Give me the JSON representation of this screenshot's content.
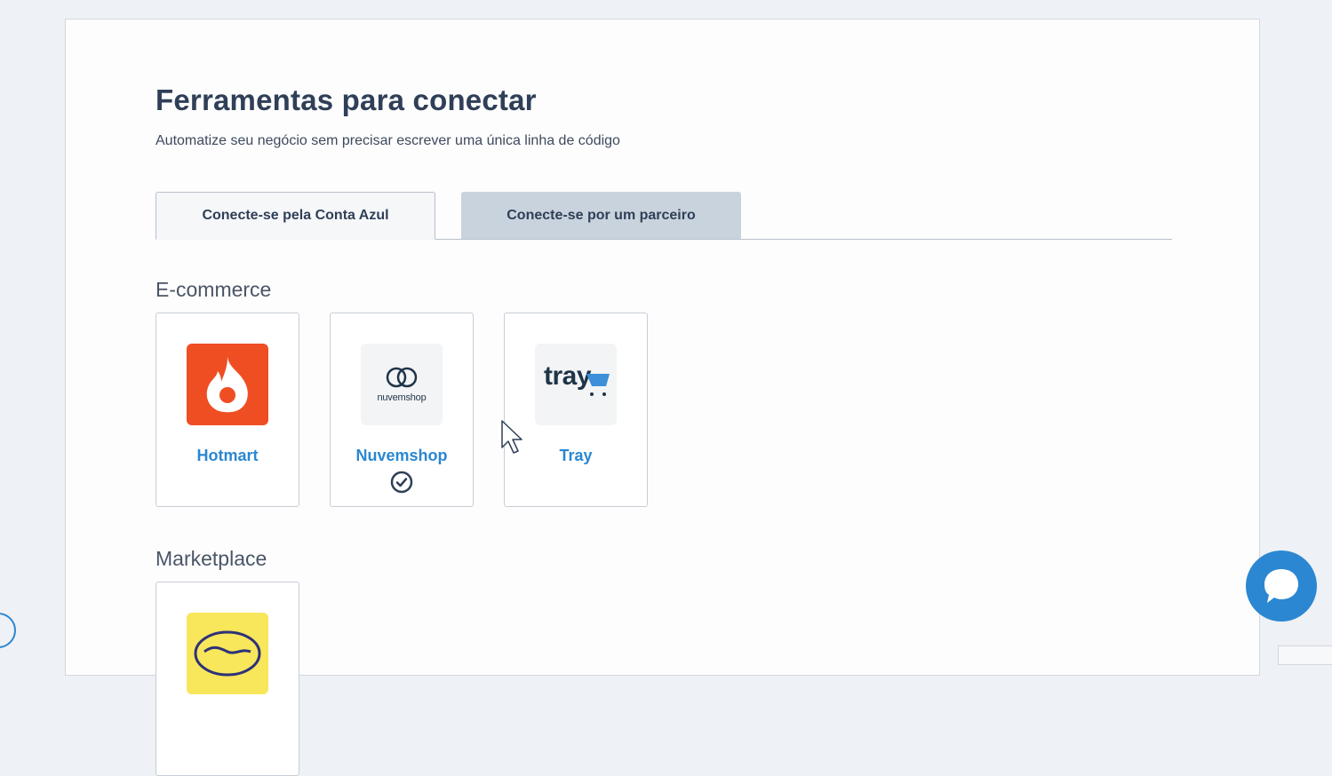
{
  "header": {
    "title": "Ferramentas para conectar",
    "subtitle": "Automatize seu negócio sem precisar escrever uma única linha de código"
  },
  "tabs": [
    {
      "label": "Conecte-se pela Conta Azul",
      "active": true
    },
    {
      "label": "Conecte-se por um parceiro",
      "active": false
    }
  ],
  "sections": {
    "ecommerce": {
      "title": "E-commerce",
      "items": [
        {
          "label": "Hotmart",
          "icon": "hotmart-logo",
          "connected": false
        },
        {
          "label": "Nuvemshop",
          "icon": "nuvemshop-logo",
          "logo_text": "nuvemshop",
          "connected": true
        },
        {
          "label": "Tray",
          "icon": "tray-logo",
          "logo_text": "tray",
          "connected": false
        }
      ]
    },
    "marketplace": {
      "title": "Marketplace",
      "items": [
        {
          "icon": "mercado-livre-logo"
        }
      ]
    }
  },
  "colors": {
    "accent": "#2b87d1",
    "title": "#2f3f57",
    "hotmart": "#ef4e23",
    "mercado_livre": "#f8e65b",
    "inactive_tab": "#c9d3dd"
  },
  "icons": [
    "hotmart-logo",
    "nuvemshop-logo",
    "tray-logo",
    "mercado-livre-logo",
    "check-circle-icon",
    "chat-icon",
    "mouse-cursor-icon"
  ]
}
